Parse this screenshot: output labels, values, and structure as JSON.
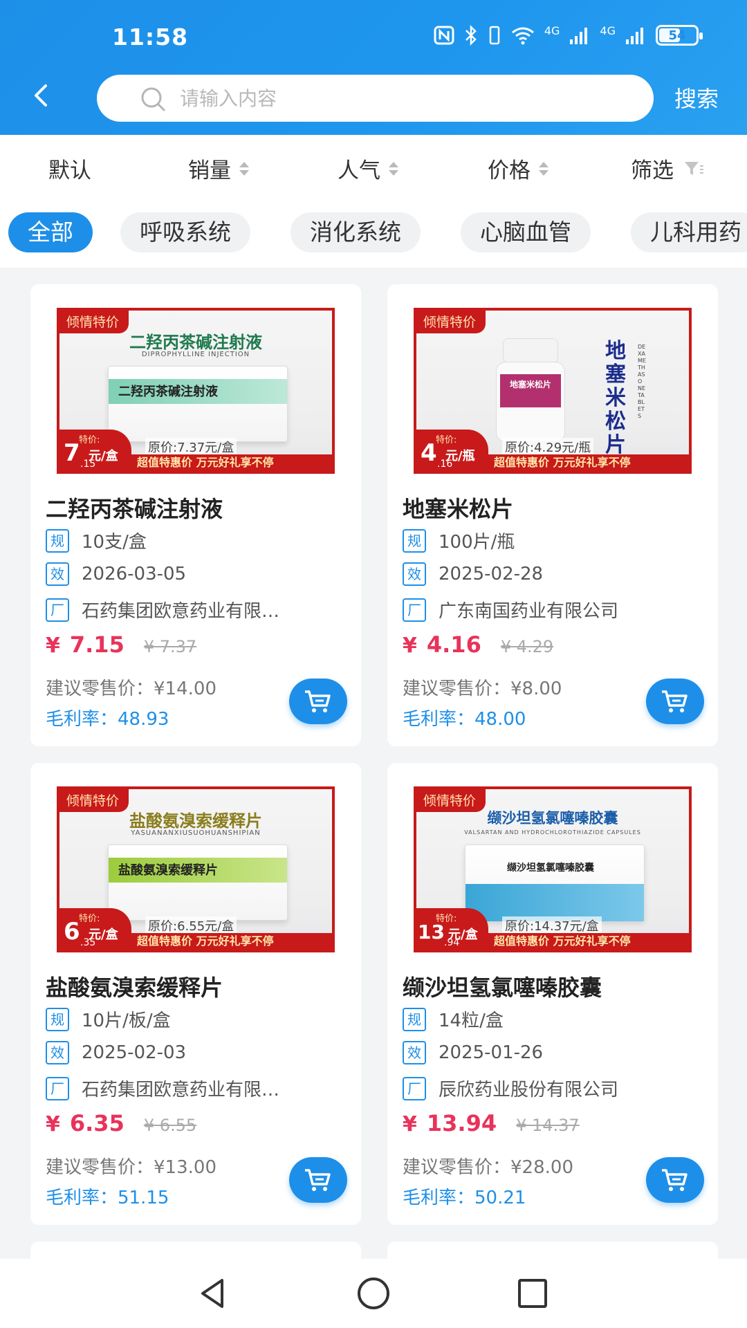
{
  "status_bar": {
    "time": "11:58",
    "battery": "54",
    "icons": [
      "nfc-icon",
      "bluetooth-icon",
      "vibrate-icon",
      "wifi-icon",
      "signal-4g-icon",
      "signal-4g-icon",
      "battery-icon"
    ],
    "net_label_1": "4G",
    "net_label_2": "4G"
  },
  "header": {
    "back_icon": "chevron-left-icon",
    "search_placeholder": "请输入内容",
    "search_button": "搜索"
  },
  "sort": {
    "default": "默认",
    "sales": "销量",
    "popularity": "人气",
    "price": "价格",
    "filter": "筛选"
  },
  "categories": [
    "全部",
    "呼吸系统",
    "消化系统",
    "心脑血管",
    "儿科用药"
  ],
  "active_category": "全部",
  "labels": {
    "spec_badge": "规",
    "expiry_badge": "效",
    "maker_badge": "厂",
    "currency": "¥",
    "retail_prefix": "建议零售价：",
    "margin_prefix": "毛利率：",
    "img_tag": "倾情特价",
    "img_special": "特价:",
    "img_promo": "超值特惠价 万元好礼享不停"
  },
  "products": [
    {
      "name": "二羟丙茶碱注射液",
      "spec": "10支/盒",
      "expiry": "2026-03-05",
      "maker": "石药集团欧意药业有限…",
      "price": "7.15",
      "old_price": "¥ 7.37",
      "retail": "¥14.00",
      "margin": "48.93",
      "img_title": "二羟丙茶碱注射液",
      "img_subtitle": "DIPROPHYLLINE INJECTION",
      "img_box_label": "二羟丙茶碱注射液",
      "img_price_int": "7",
      "img_price_unit": "元/盒",
      "img_price_dec": ".15",
      "img_orig": "原价:7.37元/盒",
      "accent": "#7fd0b5"
    },
    {
      "name": "地塞米松片",
      "spec": "100片/瓶",
      "expiry": "2025-02-28",
      "maker": "广东南国药业有限公司",
      "price": "4.16",
      "old_price": "¥ 4.29",
      "retail": "¥8.00",
      "margin": "48.00",
      "img_title": "",
      "img_subtitle": "",
      "img_box_label": "地塞米松片",
      "img_vertical": "地塞米松片",
      "img_vertical_sub": "DEXAMETHASONE TABLETS",
      "img_price_int": "4",
      "img_price_unit": "元/瓶",
      "img_price_dec": ".16",
      "img_orig": "原价:4.29元/瓶",
      "accent": "#b3306e"
    },
    {
      "name": "盐酸氨溴索缓释片",
      "spec": "10片/板/盒",
      "expiry": "2025-02-03",
      "maker": "石药集团欧意药业有限…",
      "price": "6.35",
      "old_price": "¥ 6.55",
      "retail": "¥13.00",
      "margin": "51.15",
      "img_title": "盐酸氨溴索缓释片",
      "img_subtitle": "YASUANANXIUSUOHUANSHIPIAN",
      "img_box_label": "盐酸氨溴索缓释片",
      "img_price_int": "6",
      "img_price_unit": "元/盒",
      "img_price_dec": ".35",
      "img_orig": "原价:6.55元/盒",
      "accent": "#9ccc3c"
    },
    {
      "name": "缬沙坦氢氯噻嗪胶囊",
      "spec": "14粒/盒",
      "expiry": "2025-01-26",
      "maker": "辰欣药业股份有限公司",
      "price": "13.94",
      "old_price": "¥ 14.37",
      "retail": "¥28.00",
      "margin": "50.21",
      "img_title": "缬沙坦氢氯噻嗪胶囊",
      "img_subtitle": "VALSARTAN AND HYDROCHLOROTHIAZIDE CAPSULES",
      "img_box_label": "缬沙坦氢氯噻嗪胶囊",
      "img_price_int": "13",
      "img_price_unit": "元/盒",
      "img_price_dec": ".94",
      "img_orig": "原价:14.37元/盒",
      "accent": "#3aa6d6"
    }
  ],
  "colors": {
    "primary": "#1e8fe8",
    "price": "#e8335b",
    "promo_red": "#c81a1a"
  },
  "nav": {
    "back_icon": "nav-back-icon",
    "home_icon": "nav-home-icon",
    "recents_icon": "nav-recents-icon"
  }
}
